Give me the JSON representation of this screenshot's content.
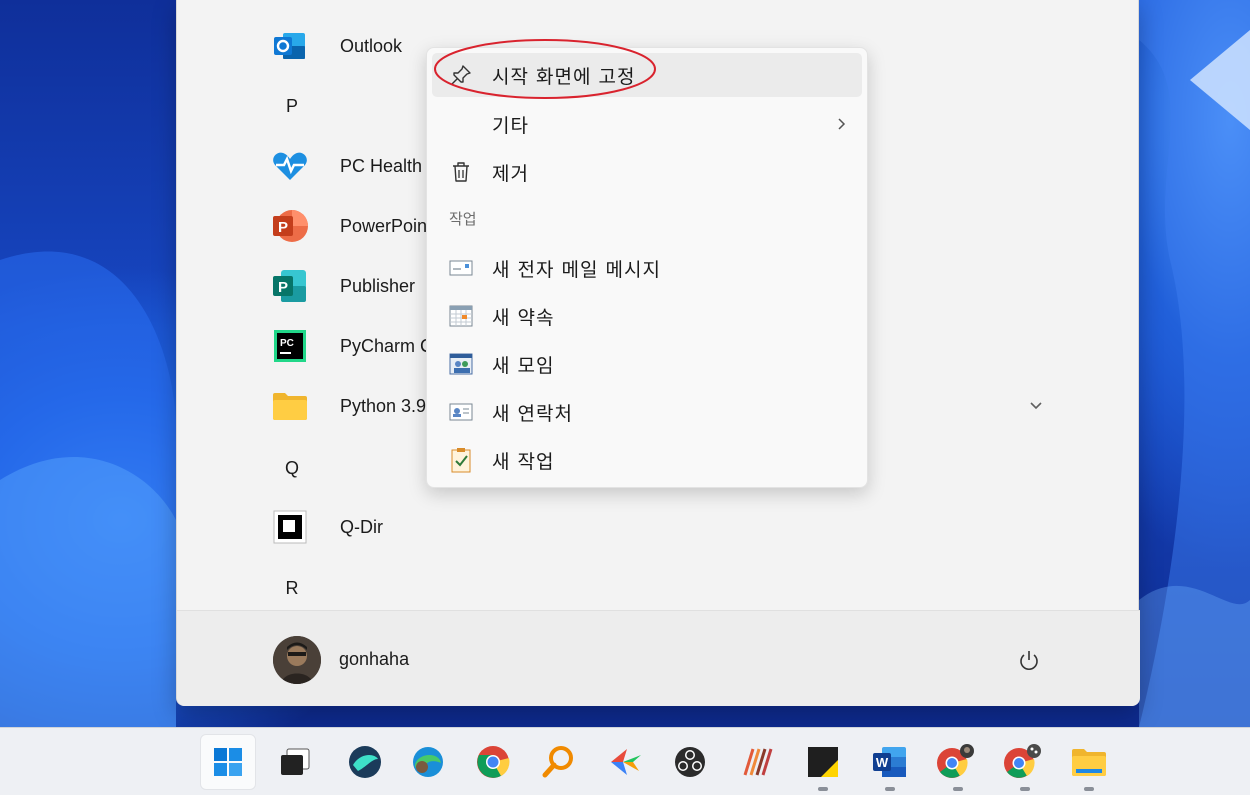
{
  "start_menu": {
    "apps": [
      {
        "label": "Outlook",
        "icon": "outlook-icon"
      },
      {
        "label": "PC Health",
        "icon": "pc-health-icon"
      },
      {
        "label": "PowerPoin",
        "icon": "powerpoint-icon"
      },
      {
        "label": "Publisher",
        "icon": "publisher-icon"
      },
      {
        "label": "PyCharm C",
        "icon": "pycharm-icon"
      },
      {
        "label": "Python 3.9",
        "icon": "folder-icon"
      },
      {
        "label": "Q-Dir",
        "icon": "q-dir-icon"
      }
    ],
    "letters": [
      "P",
      "Q",
      "R"
    ],
    "user": {
      "name": "gonhaha"
    }
  },
  "context_menu": {
    "items": [
      {
        "label": "시작 화면에 고정",
        "icon": "pin-icon"
      },
      {
        "label": "기타",
        "icon": "chevron-right-icon"
      },
      {
        "label": "제거",
        "icon": "trash-icon"
      }
    ],
    "section_label": "작업",
    "tasks": [
      {
        "label": "새 전자 메일 메시지",
        "icon": "new-mail-icon"
      },
      {
        "label": "새 약속",
        "icon": "new-appointment-icon"
      },
      {
        "label": "새 모임",
        "icon": "new-meeting-icon"
      },
      {
        "label": "새 연락처",
        "icon": "new-contact-icon"
      },
      {
        "label": "새 작업",
        "icon": "new-task-icon"
      }
    ],
    "highlight_color": "#d9232e"
  },
  "taskbar": {
    "icons": [
      "start-icon",
      "task-view-icon",
      "whale-browser-icon",
      "edge-icon",
      "chrome-icon",
      "search-tool-icon",
      "app-icon",
      "obs-icon",
      "app-icon",
      "sticky-app-icon",
      "word-icon",
      "chrome-profile-icon",
      "chrome-profile-icon",
      "file-explorer-icon"
    ]
  },
  "colors": {
    "accent": "#0067c0",
    "menu_bg": "#f3f3f3"
  }
}
